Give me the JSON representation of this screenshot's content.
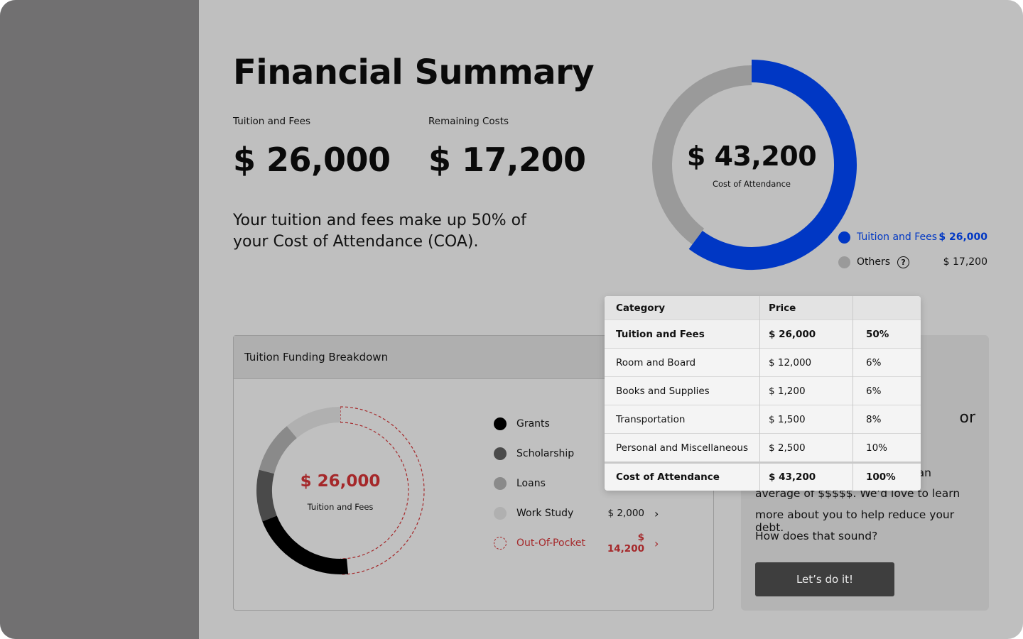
{
  "summary": {
    "title": "Financial Summary",
    "tuition_label": "Tuition and Fees",
    "tuition_value": "$ 26,000",
    "remaining_label": "Remaining Costs",
    "remaining_value": "$ 17,200",
    "description": "Your tuition and fees make up 50% of your Cost of Attendance (COA)."
  },
  "coa_donut": {
    "center_value": "$ 43,200",
    "center_label": "Cost of Attendance",
    "segments": [
      {
        "name": "Tuition and Fees",
        "amount": "$ 26,000",
        "value": 26000,
        "color": "#0037c4"
      },
      {
        "name": "Others",
        "amount": "$ 17,200",
        "value": 17200,
        "color": "#9a9a9a"
      }
    ]
  },
  "cost_table": {
    "headers": [
      "Category",
      "Price",
      ""
    ],
    "rows": [
      {
        "category": "Tuition and Fees",
        "price": "$ 26,000",
        "percent": "50%"
      },
      {
        "category": "Room and Board",
        "price": "$ 12,000",
        "percent": "6%"
      },
      {
        "category": "Books and Supplies",
        "price": "$ 1,200",
        "percent": "6%"
      },
      {
        "category": "Transportation",
        "price": "$ 1,500",
        "percent": "8%"
      },
      {
        "category": "Personal and Miscellaneous",
        "price": "$ 2,500",
        "percent": "10%"
      }
    ],
    "total": {
      "category": "Cost of Attendance",
      "price": "$ 43,200",
      "percent": "100%"
    }
  },
  "breakdown": {
    "title": "Tuition Funding Breakdown",
    "center_value": "$ 26,000",
    "center_label": "Tuition and Fees",
    "items": [
      {
        "label": "Grants",
        "amount": "",
        "color": "#000000"
      },
      {
        "label": "Scholarship",
        "amount": "",
        "color": "#4a4a4a"
      },
      {
        "label": "Loans",
        "amount": "",
        "color": "#8a8a8a"
      },
      {
        "label": "Work Study",
        "amount": "$ 2,000",
        "color": "#b0b0b0"
      },
      {
        "label": "Out-Of-Pocket",
        "amount": "$ 14,200",
        "color": "#a5282a"
      }
    ]
  },
  "promo": {
    "heading_fragment": "or",
    "line1_fragment": "an",
    "line2": "average of $$$$$. We’d love to learn",
    "line3": "more about you to help reduce your debt.",
    "line4": "How does that sound?",
    "button_label": "Let’s do it!"
  },
  "colors": {
    "accent_blue": "#0037c4",
    "out_of_pocket_red": "#a5282a",
    "sidebar": "#717071",
    "background": "#bfbfbf"
  }
}
